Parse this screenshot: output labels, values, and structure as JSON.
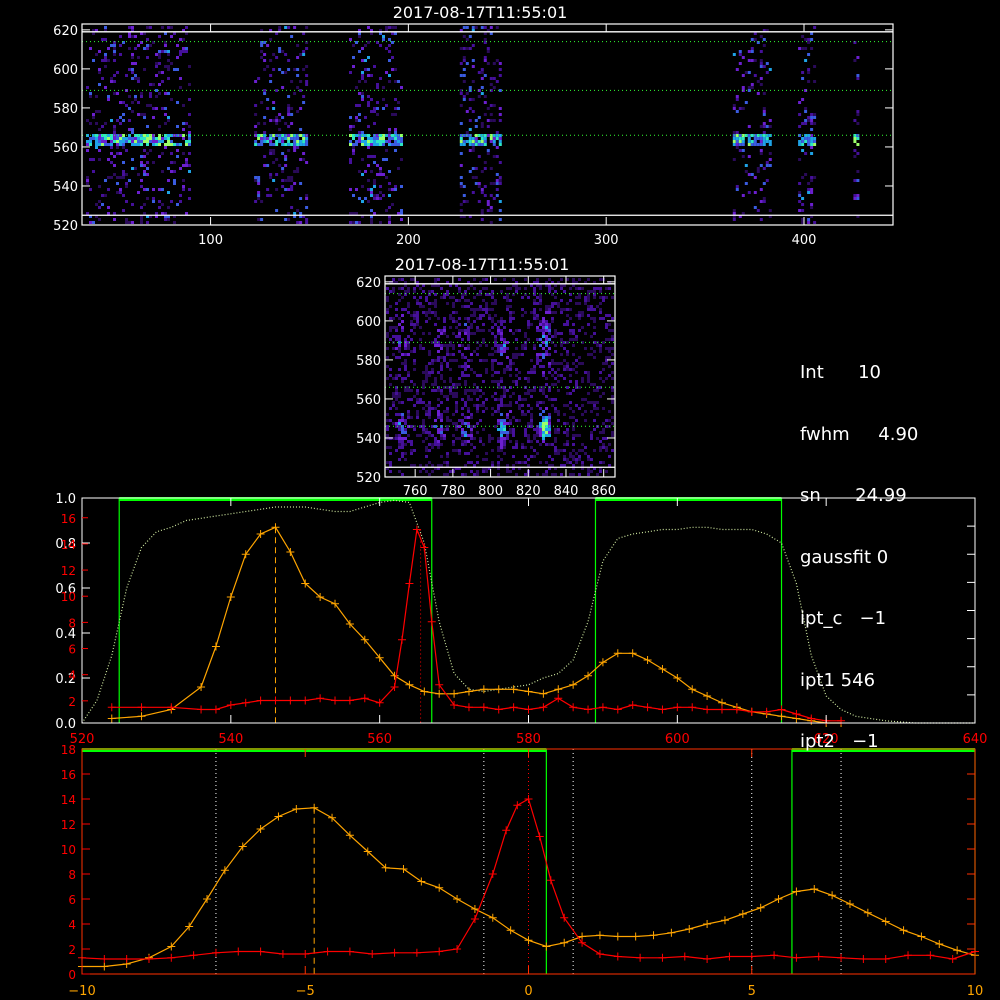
{
  "panels": {
    "top": {
      "title": "2017-08-17T11:55:01",
      "x_ticks": [
        "100",
        "200",
        "300",
        "400"
      ],
      "y_ticks": [
        "520",
        "540",
        "560",
        "580",
        "600",
        "620"
      ],
      "xlim": [
        35,
        445
      ],
      "ylim": [
        520,
        623
      ],
      "hlines_dotted": [
        614,
        589,
        566
      ],
      "hlines_solid": [
        619,
        525
      ],
      "strips": [
        [
          37,
          90
        ],
        [
          122,
          149
        ],
        [
          170,
          197
        ],
        [
          226,
          246
        ],
        [
          364,
          383
        ],
        [
          397,
          405
        ],
        [
          425,
          427
        ]
      ]
    },
    "mid": {
      "title": "2017-08-17T11:55:01",
      "x_ticks": [
        "760",
        "780",
        "800",
        "820",
        "840",
        "860"
      ],
      "y_ticks": [
        "520",
        "540",
        "560",
        "580",
        "600",
        "620"
      ],
      "xlim": [
        744,
        866
      ],
      "ylim": [
        520,
        623
      ],
      "hlines_dotted": [
        614,
        589,
        566,
        546
      ],
      "hlines_solid": [
        619,
        525
      ]
    }
  },
  "info_text": [
    "Int      10",
    "fwhm     4.90",
    "sn      24.99",
    "gaussfit 0",
    "ipt_c   −1",
    "ipt1 546",
    "ipt2   −1"
  ],
  "colors": {
    "background": "#000000",
    "axis": "#ffffff",
    "orange": "#ffa500",
    "red": "#ff0000",
    "green": "#00ff00",
    "rightaxis": "#ff3000"
  },
  "chart_data": [
    {
      "type": "heatmap",
      "title": "2017-08-17T11:55:01",
      "x_ticks": [
        "100",
        "200",
        "300",
        "400"
      ],
      "y_ticks": [
        "520",
        "540",
        "560",
        "580",
        "600",
        "620"
      ],
      "xlim": [
        35,
        445
      ],
      "ylim": [
        520,
        623
      ]
    },
    {
      "type": "heatmap",
      "title": "2017-08-17T11:55:01",
      "x_ticks": [
        "760",
        "780",
        "800",
        "820",
        "840",
        "860"
      ],
      "y_ticks": [
        "520",
        "540",
        "560",
        "580",
        "600",
        "620"
      ],
      "xlim": [
        744,
        866
      ],
      "ylim": [
        520,
        623
      ]
    },
    {
      "type": "line",
      "xlim": [
        520,
        640
      ],
      "ylim": [
        0,
        1.0
      ],
      "x_ticks": [
        "520",
        "540",
        "560",
        "580",
        "600",
        "620",
        "640"
      ],
      "y_ticks_left": [
        "0.0",
        "0.2",
        "0.4",
        "0.6",
        "0.8",
        "1.0"
      ],
      "y_ticks_right_red": [
        "2",
        "4",
        "6",
        "8",
        "10",
        "12",
        "14",
        "16"
      ],
      "y_ticks_right_axis": [
        "2",
        "4",
        "6",
        "8",
        "10",
        "12",
        "14"
      ],
      "green_band_x": [
        [
          525,
          567
        ],
        [
          589,
          614
        ]
      ],
      "dashed_x": 546,
      "dotted_x": 565.5,
      "series": [
        {
          "color": "orange",
          "x": [
            524,
            528,
            532,
            536,
            538,
            540,
            542,
            544,
            546,
            548,
            550,
            552,
            554,
            556,
            558,
            560,
            562,
            564,
            566,
            568,
            570,
            572,
            574,
            576,
            578,
            580,
            582,
            584,
            586,
            588,
            590,
            592,
            594,
            596,
            598,
            600,
            602,
            604,
            606,
            608,
            610,
            612,
            614,
            616,
            618,
            620,
            622
          ],
          "y": [
            0.02,
            0.03,
            0.06,
            0.16,
            0.34,
            0.56,
            0.75,
            0.84,
            0.87,
            0.76,
            0.62,
            0.56,
            0.53,
            0.44,
            0.37,
            0.29,
            0.21,
            0.17,
            0.14,
            0.13,
            0.13,
            0.14,
            0.15,
            0.15,
            0.15,
            0.14,
            0.13,
            0.15,
            0.17,
            0.21,
            0.27,
            0.31,
            0.31,
            0.28,
            0.24,
            0.2,
            0.15,
            0.12,
            0.09,
            0.07,
            0.05,
            0.04,
            0.03,
            0.02,
            0.01,
            0.0,
            0.0
          ]
        },
        {
          "color": "red",
          "x": [
            524,
            528,
            532,
            536,
            538,
            540,
            542,
            544,
            546,
            548,
            550,
            552,
            554,
            556,
            558,
            560,
            562,
            563,
            564,
            565,
            566,
            567,
            568,
            570,
            572,
            574,
            576,
            578,
            580,
            582,
            584,
            586,
            588,
            590,
            592,
            594,
            596,
            598,
            600,
            602,
            604,
            606,
            608,
            610,
            612,
            614,
            616,
            618,
            620,
            622
          ],
          "y": [
            0.07,
            0.07,
            0.07,
            0.06,
            0.06,
            0.08,
            0.09,
            0.1,
            0.1,
            0.1,
            0.1,
            0.11,
            0.1,
            0.1,
            0.11,
            0.09,
            0.16,
            0.37,
            0.62,
            0.86,
            0.78,
            0.45,
            0.17,
            0.08,
            0.07,
            0.07,
            0.06,
            0.07,
            0.06,
            0.07,
            0.11,
            0.07,
            0.06,
            0.07,
            0.06,
            0.08,
            0.07,
            0.06,
            0.07,
            0.07,
            0.06,
            0.06,
            0.06,
            0.05,
            0.05,
            0.06,
            0.04,
            0.02,
            0.01,
            0.01
          ]
        },
        {
          "color": "green-dotted",
          "x": [
            520,
            522,
            524,
            526,
            528,
            530,
            532,
            534,
            536,
            538,
            540,
            542,
            544,
            546,
            548,
            550,
            552,
            554,
            556,
            558,
            560,
            562,
            564,
            566,
            568,
            570,
            572,
            574,
            576,
            578,
            580,
            582,
            584,
            586,
            588,
            590,
            592,
            594,
            596,
            598,
            600,
            602,
            604,
            606,
            608,
            610,
            612,
            614,
            616,
            618,
            620,
            622,
            624,
            628,
            632,
            636,
            640
          ],
          "y": [
            0.0,
            0.1,
            0.3,
            0.6,
            0.78,
            0.85,
            0.87,
            0.9,
            0.91,
            0.92,
            0.93,
            0.94,
            0.95,
            0.96,
            0.96,
            0.96,
            0.95,
            0.94,
            0.94,
            0.96,
            0.98,
            0.99,
            0.98,
            0.8,
            0.45,
            0.22,
            0.15,
            0.14,
            0.15,
            0.16,
            0.17,
            0.2,
            0.22,
            0.28,
            0.45,
            0.72,
            0.82,
            0.84,
            0.85,
            0.86,
            0.86,
            0.87,
            0.87,
            0.86,
            0.86,
            0.86,
            0.84,
            0.8,
            0.62,
            0.3,
            0.12,
            0.06,
            0.03,
            0.01,
            0.0,
            0.0,
            0.0
          ]
        }
      ]
    },
    {
      "type": "line",
      "xlim": [
        -10,
        10
      ],
      "ylim": [
        0,
        18
      ],
      "x_ticks": [
        "−10",
        "−5",
        "0",
        "5",
        "10"
      ],
      "y_ticks_left_red": [
        "0",
        "2",
        "4",
        "6",
        "8",
        "10",
        "12",
        "14",
        "16",
        "18"
      ],
      "y_ticks_right_axis": [
        "2",
        "4",
        "6",
        "8",
        "10",
        "12",
        "14",
        "16",
        "18"
      ],
      "green_band_x": [
        [
          -15,
          0.4
        ],
        [
          5.9,
          10
        ]
      ],
      "dashed_x": -4.8,
      "dotted_x": [
        -7,
        -1,
        0,
        1,
        5,
        7
      ],
      "series": [
        {
          "color": "orange",
          "x": [
            -10,
            -9.5,
            -9,
            -8.5,
            -8,
            -7.6,
            -7.2,
            -6.8,
            -6.4,
            -6,
            -5.6,
            -5.2,
            -4.8,
            -4.4,
            -4,
            -3.6,
            -3.2,
            -2.8,
            -2.4,
            -2,
            -1.6,
            -1.2,
            -0.8,
            -0.4,
            0,
            0.4,
            0.8,
            1.2,
            1.6,
            2,
            2.4,
            2.8,
            3.2,
            3.6,
            4,
            4.4,
            4.8,
            5.2,
            5.6,
            6,
            6.4,
            6.8,
            7.2,
            7.6,
            8,
            8.4,
            8.8,
            9.2,
            9.6,
            10
          ],
          "y": [
            0.6,
            0.6,
            0.8,
            1.3,
            2.2,
            3.8,
            6.0,
            8.3,
            10.2,
            11.6,
            12.6,
            13.2,
            13.3,
            12.5,
            11.1,
            9.8,
            8.5,
            8.4,
            7.4,
            6.9,
            6.0,
            5.2,
            4.5,
            3.5,
            2.7,
            2.2,
            2.5,
            3.0,
            3.1,
            3.0,
            3.0,
            3.1,
            3.3,
            3.6,
            4.0,
            4.3,
            4.8,
            5.3,
            6.0,
            6.6,
            6.8,
            6.3,
            5.6,
            4.9,
            4.2,
            3.5,
            3.0,
            2.4,
            1.9,
            1.5
          ]
        },
        {
          "color": "red",
          "x": [
            -10,
            -9.5,
            -9,
            -8.5,
            -8,
            -7.5,
            -7,
            -6.5,
            -6,
            -5.5,
            -5,
            -4.5,
            -4,
            -3.5,
            -3,
            -2.5,
            -2,
            -1.6,
            -1.2,
            -0.8,
            -0.5,
            -0.25,
            0,
            0.25,
            0.5,
            0.8,
            1.2,
            1.6,
            2,
            2.5,
            3,
            3.5,
            4,
            4.5,
            5,
            5.5,
            6,
            6.5,
            7,
            7.5,
            8,
            8.5,
            9,
            9.5,
            10
          ],
          "y": [
            1.3,
            1.2,
            1.2,
            1.2,
            1.3,
            1.5,
            1.7,
            1.8,
            1.8,
            1.6,
            1.6,
            1.8,
            1.8,
            1.6,
            1.7,
            1.7,
            1.8,
            2.0,
            4.4,
            8.0,
            11.5,
            13.5,
            14.0,
            11.0,
            7.5,
            4.5,
            2.5,
            1.6,
            1.4,
            1.3,
            1.3,
            1.4,
            1.2,
            1.4,
            1.4,
            1.5,
            1.3,
            1.4,
            1.3,
            1.2,
            1.2,
            1.5,
            1.5,
            1.2,
            1.8
          ]
        }
      ]
    }
  ]
}
